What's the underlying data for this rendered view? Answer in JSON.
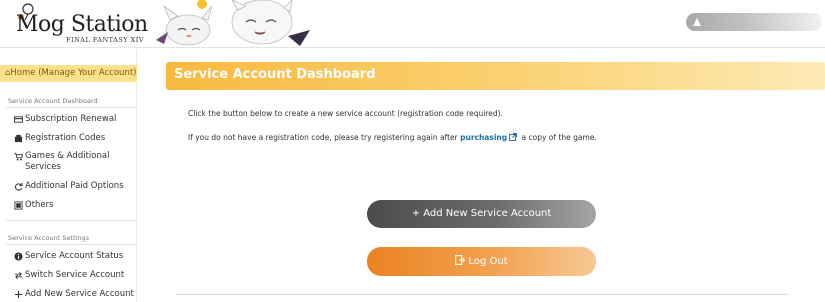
{
  "header": {
    "logo_main": "Mog Station",
    "logo_sub": "FINAL FANTASY XIV",
    "user_name": ""
  },
  "sidebar": {
    "home": "Home (Manage Your Account)",
    "section1_label": "Service Account Dashboard",
    "section1_items": [
      {
        "label": "Subscription Renewal",
        "icon": "card-icon"
      },
      {
        "label": "Registration Codes",
        "icon": "register-icon"
      },
      {
        "label": "Games & Additional Services",
        "icon": "cart-icon"
      },
      {
        "label": "Additional Paid Options",
        "icon": "refresh-icon"
      },
      {
        "label": "Others",
        "icon": "others-icon"
      }
    ],
    "section2_label": "Service Account Settings",
    "section2_items": [
      {
        "label": "Service Account Status",
        "icon": "info-icon"
      },
      {
        "label": "Switch Service Account",
        "icon": "switch-icon"
      },
      {
        "label": "Add New Service Account",
        "icon": "plus-icon"
      }
    ]
  },
  "main": {
    "title": "Service Account Dashboard",
    "paragraph1": "Click the button below to create a new service account (registration code required).",
    "paragraph2_before": "If you do not have a registration code, please try registering again after",
    "paragraph2_link": "purchasing",
    "paragraph2_after": "a copy of the game.",
    "add_button": "+ Add New Service Account",
    "logout_button": "Log Out"
  },
  "colors": {
    "accent_gold": "#f7b93f",
    "home_highlight": "#fbe08e",
    "link_blue": "#1a6fa8",
    "logout_orange": "#e98222",
    "add_button_dark": "#4b4b4b"
  }
}
